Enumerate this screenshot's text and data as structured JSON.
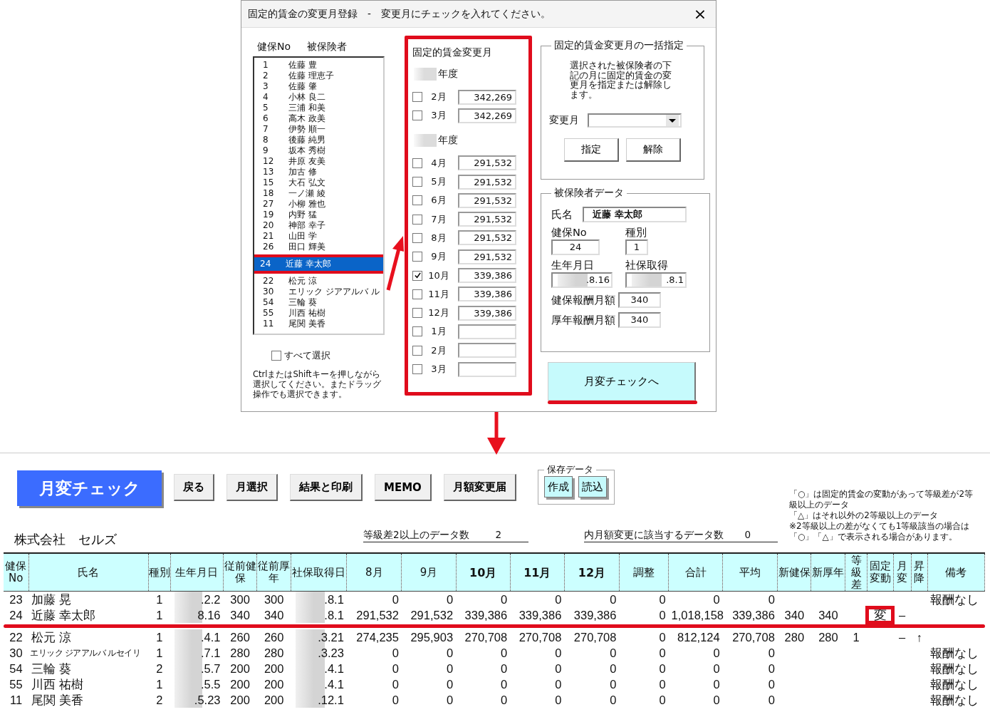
{
  "dialog": {
    "title": "固定的賃金の変更月登録　-　変更月にチェックを入れてください。",
    "close": "×",
    "list": {
      "headers": [
        "健保No",
        "被保険者"
      ],
      "items": [
        {
          "no": "1",
          "name": "佐藤 豊",
          "selected": false
        },
        {
          "no": "2",
          "name": "佐藤 理恵子",
          "selected": false
        },
        {
          "no": "3",
          "name": "佐藤 肇",
          "selected": false
        },
        {
          "no": "4",
          "name": "小林 良二",
          "selected": false
        },
        {
          "no": "5",
          "name": "三浦 和美",
          "selected": false
        },
        {
          "no": "6",
          "name": "高木 政美",
          "selected": false
        },
        {
          "no": "7",
          "name": "伊勢 順一",
          "selected": false
        },
        {
          "no": "8",
          "name": "後藤 純男",
          "selected": false
        },
        {
          "no": "9",
          "name": "坂本 秀樹",
          "selected": false
        },
        {
          "no": "12",
          "name": "井原 友美",
          "selected": false
        },
        {
          "no": "13",
          "name": "加古 修",
          "selected": false
        },
        {
          "no": "15",
          "name": "大石 弘文",
          "selected": false
        },
        {
          "no": "18",
          "name": "一ノ瀬 綾",
          "selected": false
        },
        {
          "no": "27",
          "name": "小柳 雅也",
          "selected": false
        },
        {
          "no": "19",
          "name": "内野 猛",
          "selected": false
        },
        {
          "no": "20",
          "name": "神部 幸子",
          "selected": false
        },
        {
          "no": "21",
          "name": "山田 学",
          "selected": false
        },
        {
          "no": "26",
          "name": "田口 輝美",
          "selected": false
        },
        {
          "no": "24",
          "name": "近藤 幸太郎",
          "selected": true
        },
        {
          "no": "22",
          "name": "松元 涼",
          "selected": false
        },
        {
          "no": "30",
          "name": "エリック ジアアルバ ル",
          "selected": false
        },
        {
          "no": "54",
          "name": "三輪 葵",
          "selected": false
        },
        {
          "no": "55",
          "name": "川西 祐樹",
          "selected": false
        },
        {
          "no": "11",
          "name": "尾関 美香",
          "selected": false
        }
      ]
    },
    "select_all": {
      "label": "すべて選択",
      "checked": false
    },
    "hint": "CtrlまたはShiftキーを押しながら選択してください。またドラッグ操作でも選択できます。",
    "change_months": {
      "title": "固定的賃金変更月",
      "years": [
        {
          "label": "年度",
          "months": [
            {
              "month": "2月",
              "checked": false,
              "amount": "342,269"
            },
            {
              "month": "3月",
              "checked": false,
              "amount": "342,269"
            }
          ]
        },
        {
          "label": "年度",
          "months": [
            {
              "month": "4月",
              "checked": false,
              "amount": "291,532"
            },
            {
              "month": "5月",
              "checked": false,
              "amount": "291,532"
            },
            {
              "month": "6月",
              "checked": false,
              "amount": "291,532"
            },
            {
              "month": "7月",
              "checked": false,
              "amount": "291,532"
            },
            {
              "month": "8月",
              "checked": false,
              "amount": "291,532"
            },
            {
              "month": "9月",
              "checked": false,
              "amount": "291,532"
            },
            {
              "month": "10月",
              "checked": true,
              "amount": "339,386"
            },
            {
              "month": "11月",
              "checked": false,
              "amount": "339,386"
            },
            {
              "month": "12月",
              "checked": false,
              "amount": "339,386"
            },
            {
              "month": "1月",
              "checked": false
            },
            {
              "month": "2月",
              "checked": false
            },
            {
              "month": "3月",
              "checked": false
            }
          ]
        }
      ]
    },
    "bulk": {
      "title": "固定的賃金変更月の一括指定",
      "description": "選択された被保険者の下記の月に固定的賃金の変更月を指定または解除します。",
      "month_label": "変更月",
      "buttons": [
        "指定",
        "解除"
      ]
    },
    "insured_data": {
      "title": "被保険者データ",
      "name_label": "氏名",
      "name": "近藤 幸太郎",
      "no_label": "健保No",
      "no": "24",
      "type_label": "種別",
      "type": "1",
      "birth_label": "生年月日",
      "birth": ".8.16",
      "acquired_label": "社保取得",
      "acquired": ".8.1",
      "health_label": "健保報酬月額",
      "health": "340",
      "pension_label": "厚年報酬月額",
      "pension": "340"
    },
    "go_button": "月変チェックへ"
  },
  "check_screen": {
    "title_button": "月変チェック",
    "buttons": [
      "戻る",
      "月選択",
      "結果と印刷",
      "MEMO",
      "月額変更届"
    ],
    "saved_data": {
      "title": "保存データ",
      "buttons": [
        "作成",
        "読込"
      ]
    },
    "company": "株式会社　セルズ",
    "stats": [
      {
        "label": "等級差2以上のデータ数",
        "value": "2"
      },
      {
        "label": "内月額変更に該当するデータ数",
        "value": "0"
      }
    ],
    "legend": [
      "「○」は固定的賃金の変動があって等級差が2等級以上のデータ",
      "「△」はそれ以外の2等級以上のデータ",
      "※2等級以上の差がなくても1等級該当の場合は「○」「△」で表示される場合があります。"
    ],
    "table": {
      "columns": [
        {
          "label": "健保No",
          "bold": false
        },
        {
          "label": "氏名",
          "bold": false
        },
        {
          "label": "種別",
          "bold": false
        },
        {
          "label": "生年月日",
          "bold": false
        },
        {
          "label": "従前健保",
          "bold": false
        },
        {
          "label": "従前厚年",
          "bold": false
        },
        {
          "label": "社保取得日",
          "bold": false
        },
        {
          "label": "8月",
          "bold": false
        },
        {
          "label": "9月",
          "bold": false
        },
        {
          "label": "10月",
          "bold": true
        },
        {
          "label": "11月",
          "bold": true
        },
        {
          "label": "12月",
          "bold": true
        },
        {
          "label": "調整",
          "bold": false
        },
        {
          "label": "合計",
          "bold": false
        },
        {
          "label": "平均",
          "bold": false
        },
        {
          "label": "新健保",
          "bold": false
        },
        {
          "label": "新厚年",
          "bold": false
        },
        {
          "label": "等級差",
          "bold": false
        },
        {
          "label": "固定変動",
          "bold": false
        },
        {
          "label": "月変",
          "bold": false
        },
        {
          "label": "昇降",
          "bold": false
        },
        {
          "label": "備考",
          "bold": false
        }
      ],
      "rows": [
        {
          "marked": false,
          "compact_name": false,
          "cells": [
            "23",
            "加藤 晃",
            "1",
            ".2.2",
            "300",
            "300",
            ".8.1",
            "0",
            "0",
            "0",
            "0",
            "0",
            "0",
            "0",
            "0",
            "",
            "",
            "",
            "",
            "",
            "",
            "報酬なし"
          ]
        },
        {
          "marked": true,
          "compact_name": false,
          "cells": [
            "24",
            "近藤 幸太郎",
            "1",
            "8.16",
            "340",
            "340",
            ".8.1",
            "291,532",
            "291,532",
            "339,386",
            "339,386",
            "339,386",
            "0",
            "1,018,158",
            "339,386",
            "340",
            "340",
            "",
            "変",
            "–",
            "",
            ""
          ]
        },
        {
          "marked": false,
          "compact_name": false,
          "cells": [
            "22",
            "松元 涼",
            "1",
            ".4.1",
            "260",
            "260",
            ".3.21",
            "274,235",
            "295,903",
            "270,708",
            "270,708",
            "270,708",
            "0",
            "812,124",
            "270,708",
            "280",
            "280",
            "1",
            "",
            "–",
            "↑",
            ""
          ]
        },
        {
          "marked": false,
          "compact_name": true,
          "cells": [
            "30",
            "エリック ジアアルバ ルセイリ",
            "1",
            ".7.1",
            "280",
            "280",
            ".3.23",
            "0",
            "0",
            "0",
            "0",
            "0",
            "0",
            "0",
            "0",
            "",
            "",
            "",
            "",
            "",
            "",
            "報酬なし"
          ]
        },
        {
          "marked": false,
          "compact_name": false,
          "cells": [
            "54",
            "三輪 葵",
            "2",
            ".5.7",
            "200",
            "200",
            ".4.1",
            "0",
            "0",
            "0",
            "0",
            "0",
            "0",
            "0",
            "0",
            "",
            "",
            "",
            "",
            "",
            "",
            "報酬なし"
          ]
        },
        {
          "marked": false,
          "compact_name": false,
          "cells": [
            "55",
            "川西 祐樹",
            "1",
            ".5.5",
            "200",
            "200",
            ".4.1",
            "0",
            "0",
            "0",
            "0",
            "0",
            "0",
            "0",
            "0",
            "",
            "",
            "",
            "",
            "",
            "",
            "報酬なし"
          ]
        },
        {
          "marked": false,
          "compact_name": false,
          "cells": [
            "11",
            "尾関 美香",
            "2",
            ".5.23",
            "200",
            "200",
            ".12.1",
            "0",
            "0",
            "0",
            "0",
            "0",
            "0",
            "0",
            "0",
            "",
            "",
            "",
            "",
            "",
            "",
            "報酬なし"
          ]
        }
      ]
    }
  }
}
